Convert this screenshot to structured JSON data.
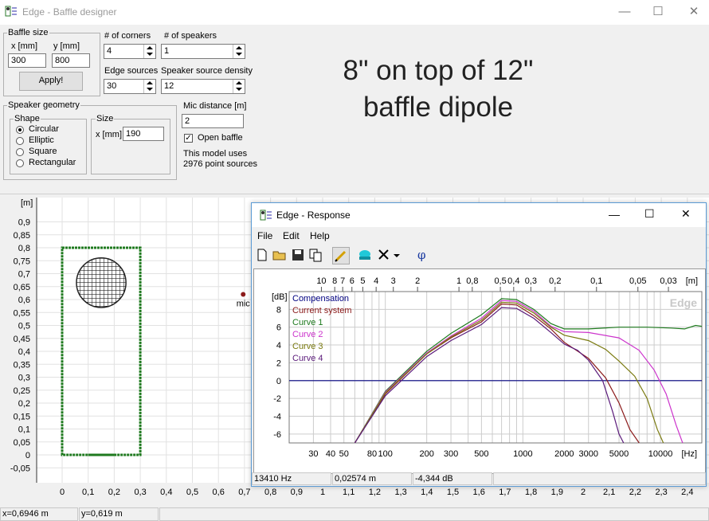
{
  "window": {
    "title": "Edge - Baffle designer",
    "minimize": "—",
    "maximize": "☐",
    "close": "✕"
  },
  "baffle_size": {
    "label": "Baffle size",
    "x_label": "x [mm]",
    "y_label": "y [mm]",
    "x_value": "300",
    "y_value": "800",
    "apply": "Apply!"
  },
  "corners": {
    "label": "# of corners",
    "value": "4"
  },
  "speakers": {
    "label": "# of speakers",
    "value": "1"
  },
  "edge_sources": {
    "label": "Edge sources",
    "value": "30"
  },
  "density": {
    "label": "Speaker source density",
    "value": "12"
  },
  "geometry": {
    "label": "Speaker geometry",
    "shape_label": "Shape",
    "shapes": [
      "Circular",
      "Elliptic",
      "Square",
      "Rectangular"
    ],
    "selected_shape": "Circular",
    "size_label": "Size",
    "size_x_label": "x [mm]",
    "size_x_value": "190"
  },
  "mic": {
    "label": "Mic distance [m]",
    "value": "2",
    "open_baffle": "Open baffle",
    "open_baffle_checked": true,
    "model_line1": "This model uses",
    "model_line2": "2976 point sources"
  },
  "note": {
    "line1": "8\" on top of 12\"",
    "line2": "baffle dipole"
  },
  "plot": {
    "unit": "[m]",
    "y_ticks": [
      "0,9",
      "0,85",
      "0,8",
      "0,75",
      "0,7",
      "0,65",
      "0,6",
      "0,55",
      "0,5",
      "0,45",
      "0,4",
      "0,35",
      "0,3",
      "0,25",
      "0,2",
      "0,15",
      "0,1",
      "0,05",
      "0",
      "-0,05"
    ],
    "x_ticks": [
      "0",
      "0,1",
      "0,2",
      "0,3",
      "0,4",
      "0,5",
      "0,6",
      "0,7",
      "0,8",
      "0,9",
      "1",
      "1,1",
      "1,2",
      "1,3",
      "1,4",
      "1,5",
      "1,6",
      "1,7",
      "1,8",
      "1,9",
      "2",
      "2,1",
      "2,2",
      "2,3",
      "2,4"
    ],
    "mic_label": "mic"
  },
  "status": {
    "x": "x=0,6946 m",
    "y": "y=0,619 m"
  },
  "response": {
    "title": "Edge - Response",
    "menu": [
      "File",
      "Edit",
      "Help"
    ],
    "top_unit": "[m]",
    "top_ticks": [
      "10",
      "8",
      "7",
      "6",
      "5",
      "4",
      "3",
      "2",
      "1",
      "0,8",
      "0,5",
      "0,4",
      "0,3",
      "0,2",
      "0,1",
      "0,05",
      "0,03"
    ],
    "db_unit": "[dB]",
    "db_ticks": [
      "8",
      "6",
      "4",
      "2",
      "0",
      "-2",
      "-4",
      "-6"
    ],
    "hz_ticks": [
      "30",
      "40",
      "50",
      "80",
      "100",
      "200",
      "300",
      "500",
      "1000",
      "2000",
      "3000",
      "5000",
      "10000"
    ],
    "hz_unit": "[Hz]",
    "watermark": "Edge",
    "legend": [
      {
        "name": "Compensation",
        "color": "#000080"
      },
      {
        "name": "Current system",
        "color": "#8b1a1a"
      },
      {
        "name": "Curve 1",
        "color": "#1e7a1e"
      },
      {
        "name": "Curve 2",
        "color": "#cc33cc"
      },
      {
        "name": "Curve 3",
        "color": "#7a7a10"
      },
      {
        "name": "Curve 4",
        "color": "#5a1a7a"
      }
    ],
    "status": {
      "freq": "13410 Hz",
      "dist": "0,02574 m",
      "level": "-4,344 dB"
    }
  },
  "chart_data": {
    "type": "line",
    "xlabel": "[Hz]",
    "ylabel": "[dB]",
    "x_scale": "log",
    "xlim": [
      20,
      20000
    ],
    "ylim": [
      -7,
      10
    ],
    "series": [
      {
        "name": "Compensation",
        "x": [
          20,
          20000
        ],
        "y": [
          0,
          0
        ]
      },
      {
        "name": "Current system",
        "x": [
          60,
          100,
          200,
          300,
          500,
          700,
          900,
          1200,
          1600,
          2000,
          3000,
          4000,
          5000,
          6000,
          7000
        ],
        "y": [
          -7,
          -1.5,
          3,
          4.8,
          6.6,
          8.6,
          8.5,
          7.3,
          5.8,
          4.3,
          2.5,
          0.3,
          -2.5,
          -5.5,
          -7
        ]
      },
      {
        "name": "Curve 1",
        "x": [
          60,
          100,
          200,
          300,
          500,
          700,
          900,
          1200,
          1600,
          2000,
          3000,
          5000,
          8000,
          12000,
          15000,
          18000,
          20000
        ],
        "y": [
          -7,
          -1.2,
          3.3,
          5.3,
          7.4,
          9.2,
          9.1,
          8,
          6.4,
          5.8,
          5.8,
          6,
          6,
          5.9,
          5.8,
          6.2,
          6.1
        ]
      },
      {
        "name": "Curve 2",
        "x": [
          60,
          100,
          200,
          300,
          500,
          700,
          900,
          1200,
          1600,
          2000,
          3000,
          5000,
          7000,
          9000,
          11000,
          13000,
          14500
        ],
        "y": [
          -7,
          -1.3,
          3.1,
          5,
          7,
          9,
          8.9,
          7.8,
          6.1,
          5.5,
          5.4,
          4.8,
          3.4,
          1.2,
          -1.5,
          -5,
          -7
        ]
      },
      {
        "name": "Curve 3",
        "x": [
          60,
          100,
          200,
          300,
          500,
          700,
          900,
          1200,
          1600,
          2000,
          3000,
          4000,
          5000,
          6500,
          8000,
          9500,
          10500
        ],
        "y": [
          -7,
          -1.4,
          3,
          4.9,
          6.8,
          8.8,
          8.7,
          7.6,
          6,
          5.1,
          4.5,
          3.5,
          2.2,
          0.5,
          -2,
          -5.5,
          -7
        ]
      },
      {
        "name": "Curve 4",
        "x": [
          60,
          100,
          200,
          300,
          500,
          700,
          900,
          1200,
          1600,
          2000,
          2500,
          3000,
          3800,
          4500,
          5000,
          5400
        ],
        "y": [
          -7,
          -1.7,
          2.7,
          4.5,
          6.3,
          8.2,
          8.1,
          7,
          5.4,
          4.1,
          3.4,
          2.3,
          0,
          -3.5,
          -6,
          -7
        ]
      }
    ]
  }
}
